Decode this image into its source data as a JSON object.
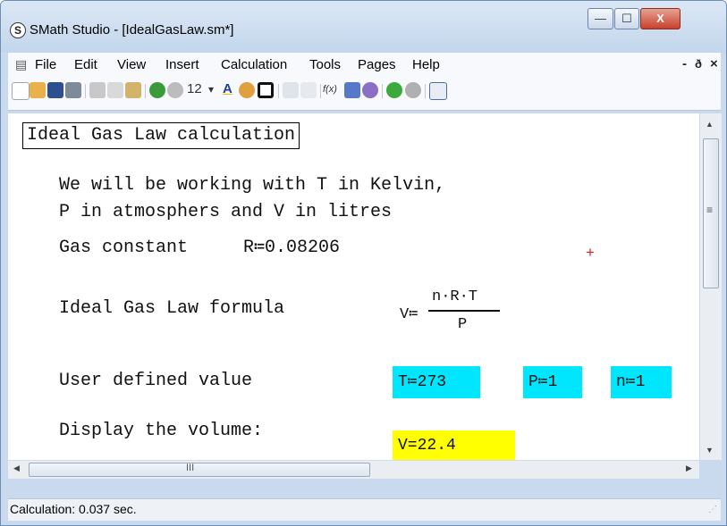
{
  "window": {
    "title": "SMath Studio - [IdealGasLaw.sm*]",
    "app_icon": "S"
  },
  "controls": {
    "minimize": "—",
    "maximize": "☐",
    "close": "X"
  },
  "menu": {
    "items": [
      "File",
      "Edit",
      "View",
      "Insert",
      "Calculation",
      "Tools",
      "Pages",
      "Help"
    ],
    "doc_minimize": "-",
    "doc_restore": "ð",
    "doc_close": "×"
  },
  "toolbar": {
    "font_size": "12",
    "font_dropdown": "▾",
    "text_style": "A",
    "function_label": "f(x)"
  },
  "worksheet": {
    "title": "Ideal Gas Law calculation",
    "text_line1": "We will be working with T in Kelvin,",
    "text_line2": "P in atmosphers and V in litres",
    "gas_constant_label": "Gas constant",
    "gas_constant_expr": "R≔0.08206",
    "cursor_mark": "+",
    "formula_label": "Ideal Gas Law formula",
    "formula_lhs": "V≔",
    "formula_numerator": "n·R·T",
    "formula_denominator": "P",
    "user_values_label": "User defined value",
    "t_expr": "T≔273",
    "p_expr": "P≔1",
    "n_expr": "n≔1",
    "display_label": "Display the volume:",
    "result_expr": "V=22.4"
  },
  "scrollbar": {
    "up": "▲",
    "down": "▼",
    "left": "◀",
    "right": "▶",
    "grip": "≡",
    "hgrip": "III"
  },
  "status": {
    "text": "Calculation: 0.037 sec."
  },
  "colors": {
    "highlight_cyan": "#00e6ff",
    "highlight_yellow": "#ffff00",
    "cursor_red": "#e02020"
  }
}
